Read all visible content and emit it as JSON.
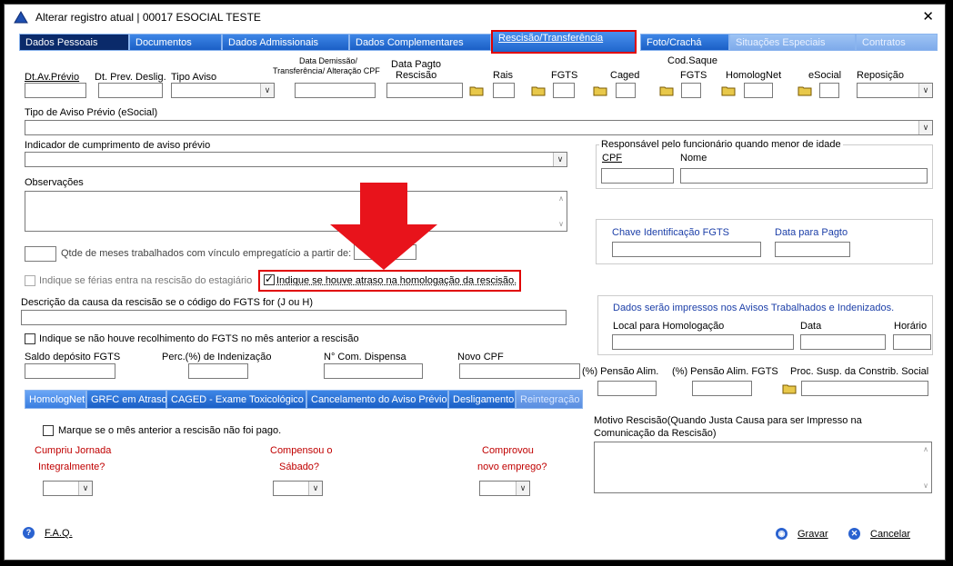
{
  "window": {
    "title": "Alterar registro atual | 00017 ESOCIAL TESTE",
    "close": "✕"
  },
  "tabs": [
    {
      "label": "Dados Pessoais"
    },
    {
      "label": "Documentos"
    },
    {
      "label": "Dados Admissionais"
    },
    {
      "label": "Dados Complementares"
    },
    {
      "label": "Rescisão/Transferência"
    },
    {
      "label": "Foto/Crachá"
    },
    {
      "label": "Situações Especiais"
    },
    {
      "label": "Contratos"
    }
  ],
  "fields": {
    "dt_av_previo": "Dt.Av.Prévio",
    "dt_prev_deslig": "Dt. Prev. Deslig.",
    "tipo_aviso": "Tipo Aviso",
    "data_demissao_1": "Data Demissão/",
    "data_demissao_2": "Transferência/ Alteração CPF",
    "data_pagto_1": "Data Pagto",
    "data_pagto_2": "Rescisão",
    "rais": "Rais",
    "fgts": "FGTS",
    "caged": "Caged",
    "cod_saque_1": "Cod.Saque",
    "cod_saque_2": "FGTS",
    "homolognet": "HomologNet",
    "esocial": "eSocial",
    "reposicao": "Reposição",
    "tipo_aviso_esocial": "Tipo de Aviso Prévio (eSocial)",
    "indicador_cumprimento": "Indicador de cumprimento de aviso prévio",
    "responsavel_menor": "Responsável pelo funcionário quando menor de idade",
    "cpf": "CPF",
    "nome": "Nome",
    "observacoes": "Observações",
    "chave_fgts": "Chave Identificação FGTS",
    "data_pagto_fgts": "Data para Pagto",
    "qtde_meses": "Qtde de meses trabalhados com vínculo empregatício a partir de:",
    "ferias_estagiario": "Indique se férias entra na rescisão do estagiário",
    "atraso_homologacao": "Indique se houve atraso na homologação da rescisão.",
    "descricao_causa": "Descrição da causa da rescisão se o código do FGTS for (J ou H)",
    "nao_recolhimento": "Indique se não houve recolhimento do FGTS no mês anterior a rescisão",
    "dados_impressos": "Dados serão impressos nos Avisos Trabalhados e Indenizados.",
    "local_homologacao": "Local para Homologação",
    "data": "Data",
    "horario": "Horário",
    "saldo_fgts": "Saldo depósito FGTS",
    "perc_indenizacao": "Perc.(%)  de Indenização",
    "n_com_dispensa": "N° Com. Dispensa",
    "novo_cpf": "Novo CPF",
    "pensao_alim": "(%)  Pensão Alim.",
    "pensao_alim_fgts": "(%)  Pensão Alim. FGTS",
    "proc_susp": "Proc. Susp. da Constrib. Social",
    "motivo_rescisao_1": "Motivo Rescisão(Quando Justa Causa para ser Impresso na",
    "motivo_rescisao_2": "Comunicação da Rescisão)"
  },
  "bottom_tabs": [
    {
      "label": "HomologNet"
    },
    {
      "label": "GRFC em Atraso"
    },
    {
      "label": "CAGED - Exame Toxicológico"
    },
    {
      "label": "Cancelamento do Aviso Prévio"
    },
    {
      "label": "Desligamento"
    },
    {
      "label": "Reintegração"
    }
  ],
  "homolognet": {
    "mes_anterior": "Marque se o mês anterior a rescisão não foi pago.",
    "cumpriu_1": "Cumpriu Jornada",
    "cumpriu_2": "Integralmente?",
    "compensou_1": "Compensou o",
    "compensou_2": "Sábado?",
    "comprovou_1": "Comprovou",
    "comprovou_2": "novo emprego?"
  },
  "footer": {
    "faq": "F.A.Q.",
    "gravar": "Gravar",
    "cancelar": "Cancelar"
  },
  "colors": {
    "tab_blue": "#1a5fc6",
    "highlight_red": "#e00000",
    "arrow_red": "#e8131b",
    "label_blue": "#1c3fa8"
  }
}
